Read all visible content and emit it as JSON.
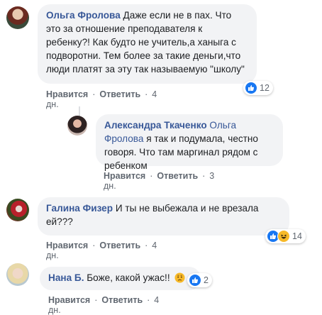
{
  "comments": [
    {
      "author": "Ольга Фролова",
      "text": "Даже если не в пах. Что это за отношение преподавателя к ребенку?! Как будто не учитель,а ханыга с подворотни. Тем более за такие деньги,что люди платят за эту так называемую \"школу\"",
      "like": "Нравится",
      "reply": "Ответить",
      "time": "4 дн.",
      "reaction_count": "12",
      "reactions": [
        "like-icon"
      ],
      "avatar_color": "#5a3a2a"
    },
    {
      "author": "Александра Ткаченко",
      "mention": "Ольга Фролова",
      "text": "я так и подумала, честно говоря. Что там маргинал рядом с ребенком",
      "like": "Нравится",
      "reply": "Ответить",
      "time": "3 дн.",
      "avatar_color": "#2e2a2a"
    },
    {
      "author": "Галина Физер",
      "text": "И ты не выбежала и не врезала ей???",
      "like": "Нравится",
      "reply": "Ответить",
      "time": "4 дн.",
      "reaction_count": "14",
      "reactions": [
        "like-icon",
        "haha-icon"
      ],
      "avatar_color": "#6b3a30"
    },
    {
      "author": "Нана Б.",
      "text": "Боже, какой ужас!!",
      "like": "Нравится",
      "reply": "Ответить",
      "time": "4 дн.",
      "reaction_count": "2",
      "reactions": [
        "like-icon"
      ],
      "avatar_color": "#d8c7a8"
    }
  ],
  "separator": "·",
  "colors": {
    "author": "#385898",
    "bubble": "#f2f3f5",
    "like_blue": "#1877f2",
    "haha_yellow": "#f7b928"
  }
}
